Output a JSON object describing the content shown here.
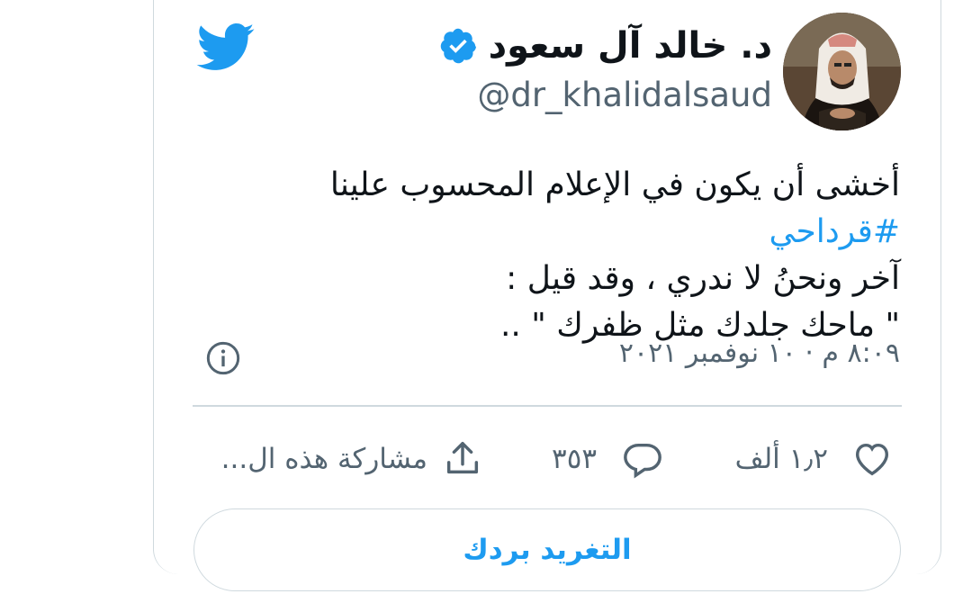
{
  "author": {
    "display_name": "د. خالد آل سعود",
    "handle": "@dr_khalidalsaud",
    "verified": true,
    "avatar": "avatar-photo"
  },
  "tweet": {
    "text_line1_start": "أخشى أن يكون في الإعلام المحسوب علينا ",
    "hashtag": "#قرداحي",
    "text_line2": "آخر ونحنُ لا ندري ، وقد قيل :",
    "text_line3": "\" ماحك جلدك مثل ظفرك \" ..",
    "timestamp": "٨:٠٩ م · ١٠ نوفمبر ٢٠٢١"
  },
  "actions": {
    "likes": "١٫٢ ألف",
    "replies": "٣٥٣",
    "share": "مشاركة هذه ال..."
  },
  "reply_button": "التغريد بردك",
  "icons": {
    "brand": "twitter-bird-icon",
    "verified": "verified-badge-icon",
    "info": "info-icon",
    "like": "heart-icon",
    "reply": "speech-bubble-icon",
    "share": "share-upload-icon"
  },
  "colors": {
    "accent": "#1d9bf0",
    "text": "#0f1419",
    "muted": "#536471",
    "border": "#cfd9de"
  }
}
